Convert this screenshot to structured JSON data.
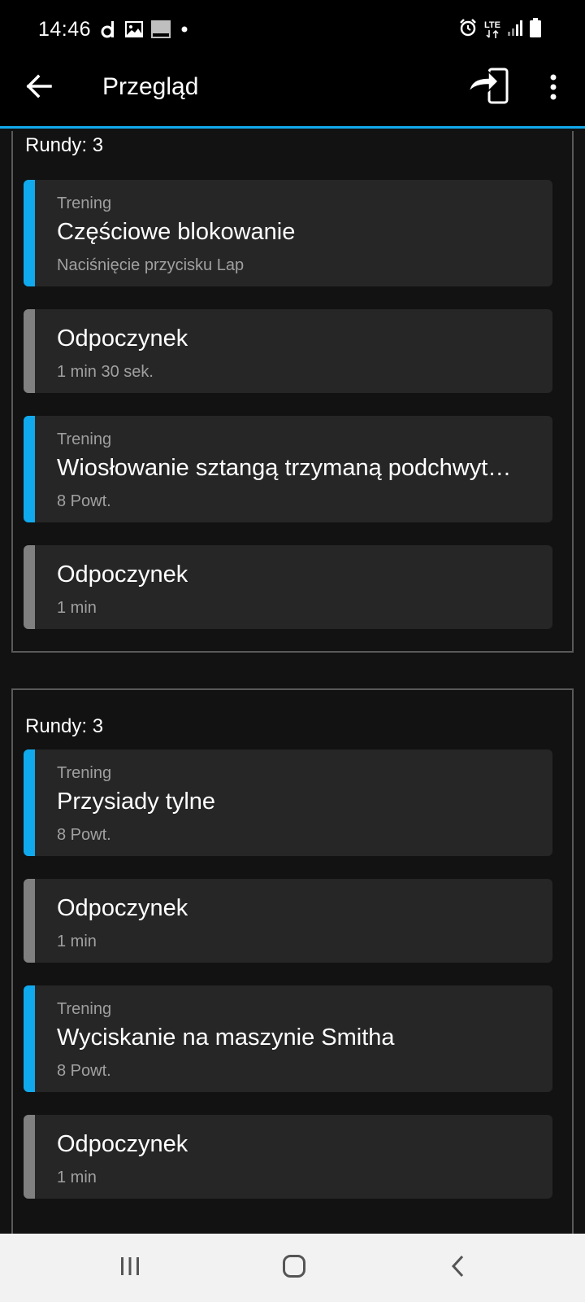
{
  "status_bar": {
    "time": "14:46",
    "left_icons": [
      "d-app-icon",
      "image-icon",
      "orange-icon",
      "dot-icon"
    ],
    "right_icons": [
      "alarm-icon",
      "lte-icon",
      "signal-icon",
      "battery-icon"
    ],
    "network_label": "LTE"
  },
  "app_bar": {
    "title": "Przegląd",
    "back_icon": "arrow-left-icon",
    "send_icon": "send-to-device-icon",
    "more_icon": "more-vertical-icon"
  },
  "groups": [
    {
      "rounds_label": "Rundy: 3",
      "steps": [
        {
          "kind": "work",
          "type": "Trening",
          "name": "Częściowe blokowanie",
          "detail": "Naciśnięcie przycisku Lap"
        },
        {
          "kind": "rest",
          "name": "Odpoczynek",
          "detail": "1 min 30 sek."
        },
        {
          "kind": "work",
          "type": "Trening",
          "name": "Wiosłowanie sztangą trzymaną podchwyt…",
          "detail": "8 Powt."
        },
        {
          "kind": "rest",
          "name": "Odpoczynek",
          "detail": "1 min"
        }
      ]
    },
    {
      "rounds_label": "Rundy: 3",
      "steps": [
        {
          "kind": "work",
          "type": "Trening",
          "name": "Przysiady tylne",
          "detail": "8 Powt."
        },
        {
          "kind": "rest",
          "name": "Odpoczynek",
          "detail": "1 min"
        },
        {
          "kind": "work",
          "type": "Trening",
          "name": "Wyciskanie na maszynie Smitha",
          "detail": "8 Powt."
        },
        {
          "kind": "rest",
          "name": "Odpoczynek",
          "detail": "1 min"
        }
      ]
    }
  ],
  "colors": {
    "accent_work": "#11a9ed",
    "accent_rest": "#808080",
    "card_background": "#262626",
    "app_background": "#121212"
  },
  "nav_bar": {
    "recents_icon": "recents-icon",
    "home_icon": "home-icon",
    "back_icon": "nav-back-icon"
  }
}
